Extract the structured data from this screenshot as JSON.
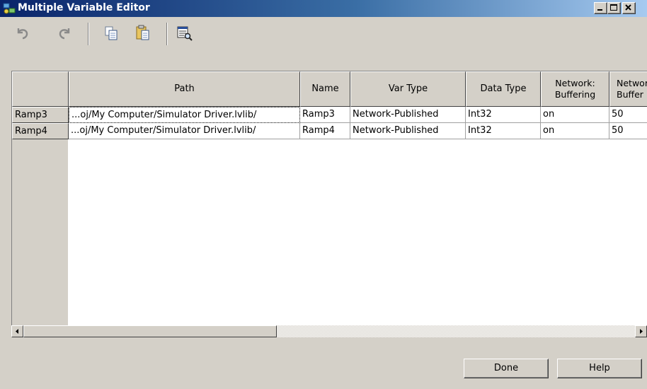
{
  "window": {
    "title": "Multiple Variable Editor",
    "minimize_symbol": "_",
    "maximize_symbol": "□",
    "close_symbol": "×"
  },
  "toolbar": {
    "icons": [
      "undo-icon",
      "redo-icon",
      "copy-icon",
      "paste-icon",
      "properties-icon"
    ]
  },
  "table": {
    "columns": [
      {
        "label": ""
      },
      {
        "label": "Path"
      },
      {
        "label": "Name"
      },
      {
        "label": "Var Type"
      },
      {
        "label": "Data Type"
      },
      {
        "label": "Network: Buffering"
      },
      {
        "label": "Network: Buffer"
      }
    ],
    "rows": [
      {
        "header": "Ramp3",
        "path": "...oj/My Computer/Simulator Driver.lvlib/",
        "name": "Ramp3",
        "var_type": "Network-Published",
        "data_type": "Int32",
        "buffering": "on",
        "buffer": "50"
      },
      {
        "header": "Ramp4",
        "path": "...oj/My Computer/Simulator Driver.lvlib/",
        "name": "Ramp4",
        "var_type": "Network-Published",
        "data_type": "Int32",
        "buffering": "on",
        "buffer": "50"
      }
    ]
  },
  "buttons": {
    "done": "Done",
    "help": "Help"
  },
  "colors": {
    "titlebar_start": "#0a246a",
    "titlebar_end": "#a6caf0",
    "face": "#d4d0c8"
  }
}
